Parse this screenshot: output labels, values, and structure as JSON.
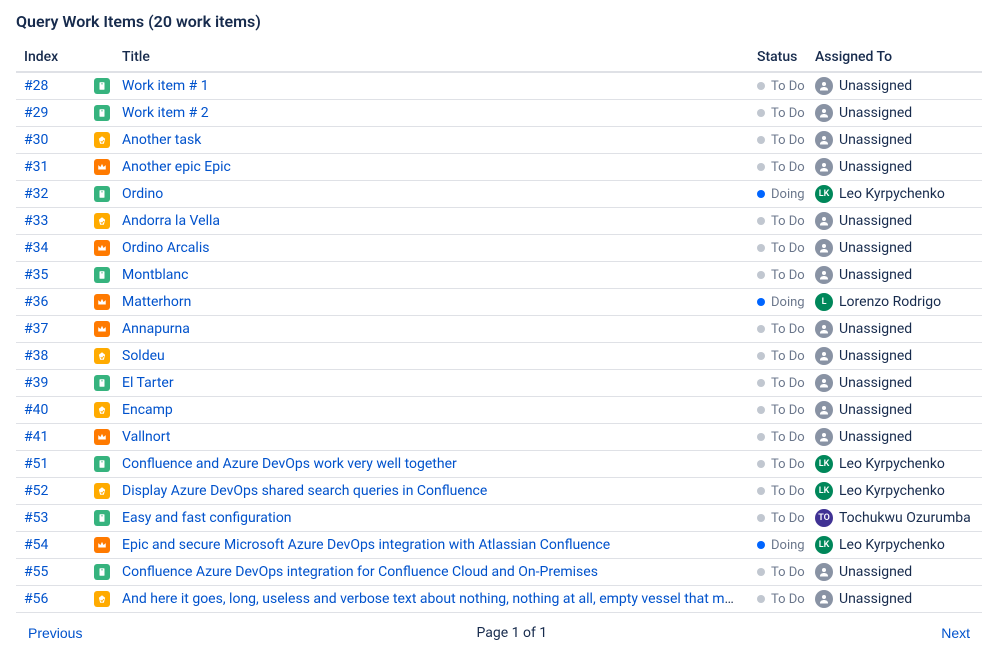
{
  "title": "Query Work Items (20 work items)",
  "columns": {
    "index": "Index",
    "title": "Title",
    "status": "Status",
    "assigned": "Assigned To"
  },
  "pager": {
    "prev": "Previous",
    "info": "Page 1 of 1",
    "next": "Next"
  },
  "unassigned_label": "Unassigned",
  "rows": [
    {
      "index": "#28",
      "type": "task",
      "title": "Work item # 1",
      "status": "todo",
      "status_label": "To Do",
      "assigned": "unassigned",
      "assigned_name": "Unassigned",
      "initials": ""
    },
    {
      "index": "#29",
      "type": "task",
      "title": "Work item # 2",
      "status": "todo",
      "status_label": "To Do",
      "assigned": "unassigned",
      "assigned_name": "Unassigned",
      "initials": ""
    },
    {
      "index": "#30",
      "type": "epic",
      "title": "Another task",
      "status": "todo",
      "status_label": "To Do",
      "assigned": "unassigned",
      "assigned_name": "Unassigned",
      "initials": ""
    },
    {
      "index": "#31",
      "type": "crown",
      "title": "Another epic Epic",
      "status": "todo",
      "status_label": "To Do",
      "assigned": "unassigned",
      "assigned_name": "Unassigned",
      "initials": ""
    },
    {
      "index": "#32",
      "type": "task",
      "title": "Ordino",
      "status": "doing",
      "status_label": "Doing",
      "assigned": "green",
      "assigned_name": "Leo Kyrpychenko",
      "initials": "LK"
    },
    {
      "index": "#33",
      "type": "epic",
      "title": "Andorra la Vella",
      "status": "todo",
      "status_label": "To Do",
      "assigned": "unassigned",
      "assigned_name": "Unassigned",
      "initials": ""
    },
    {
      "index": "#34",
      "type": "crown",
      "title": "Ordino Arcalis",
      "status": "todo",
      "status_label": "To Do",
      "assigned": "unassigned",
      "assigned_name": "Unassigned",
      "initials": ""
    },
    {
      "index": "#35",
      "type": "task",
      "title": "Montblanc",
      "status": "todo",
      "status_label": "To Do",
      "assigned": "unassigned",
      "assigned_name": "Unassigned",
      "initials": ""
    },
    {
      "index": "#36",
      "type": "crown",
      "title": "Matterhorn",
      "status": "doing",
      "status_label": "Doing",
      "assigned": "green",
      "assigned_name": "Lorenzo Rodrigo",
      "initials": "L"
    },
    {
      "index": "#37",
      "type": "crown",
      "title": "Annapurna",
      "status": "todo",
      "status_label": "To Do",
      "assigned": "unassigned",
      "assigned_name": "Unassigned",
      "initials": ""
    },
    {
      "index": "#38",
      "type": "epic",
      "title": "Soldeu",
      "status": "todo",
      "status_label": "To Do",
      "assigned": "unassigned",
      "assigned_name": "Unassigned",
      "initials": ""
    },
    {
      "index": "#39",
      "type": "task",
      "title": "El Tarter",
      "status": "todo",
      "status_label": "To Do",
      "assigned": "unassigned",
      "assigned_name": "Unassigned",
      "initials": ""
    },
    {
      "index": "#40",
      "type": "epic",
      "title": "Encamp",
      "status": "todo",
      "status_label": "To Do",
      "assigned": "unassigned",
      "assigned_name": "Unassigned",
      "initials": ""
    },
    {
      "index": "#41",
      "type": "crown",
      "title": "Vallnort",
      "status": "todo",
      "status_label": "To Do",
      "assigned": "unassigned",
      "assigned_name": "Unassigned",
      "initials": ""
    },
    {
      "index": "#51",
      "type": "task",
      "title": "Confluence and Azure DevOps work very well together",
      "status": "todo",
      "status_label": "To Do",
      "assigned": "green",
      "assigned_name": "Leo Kyrpychenko",
      "initials": "LK"
    },
    {
      "index": "#52",
      "type": "epic",
      "title": "Display Azure DevOps shared search queries in Confluence",
      "status": "todo",
      "status_label": "To Do",
      "assigned": "green",
      "assigned_name": "Leo Kyrpychenko",
      "initials": "LK"
    },
    {
      "index": "#53",
      "type": "task",
      "title": "Easy and fast configuration",
      "status": "todo",
      "status_label": "To Do",
      "assigned": "purple",
      "assigned_name": "Tochukwu Ozurumba",
      "initials": "TO"
    },
    {
      "index": "#54",
      "type": "crown",
      "title": "Epic and secure Microsoft Azure DevOps integration with Atlassian Confluence",
      "status": "doing",
      "status_label": "Doing",
      "assigned": "green",
      "assigned_name": "Leo Kyrpychenko",
      "initials": "LK"
    },
    {
      "index": "#55",
      "type": "task",
      "title": "Confluence Azure DevOps integration for Confluence Cloud and On-Premises",
      "status": "todo",
      "status_label": "To Do",
      "assigned": "unassigned",
      "assigned_name": "Unassigned",
      "initials": ""
    },
    {
      "index": "#56",
      "type": "epic",
      "title": "And here it goes, long, useless and verbose text about nothing, nothing at all, empty vessel that merely a monument to lost time, as usual...",
      "status": "todo",
      "status_label": "To Do",
      "assigned": "unassigned",
      "assigned_name": "Unassigned",
      "initials": ""
    }
  ]
}
